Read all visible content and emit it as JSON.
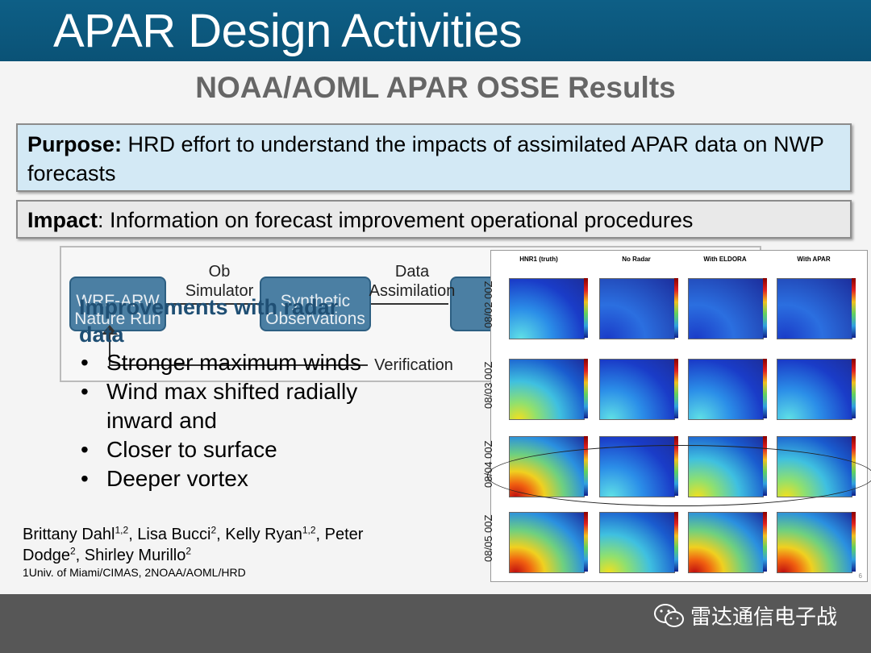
{
  "header": {
    "title": "APAR Design Activities"
  },
  "subtitle": "NOAA/AOML APAR OSSE Results",
  "purpose": {
    "label": "Purpose:",
    "text": " HRD effort to understand the impacts of assimilated APAR data on NWP forecasts"
  },
  "impact": {
    "label": "Impact",
    "text": ": Information on forecast improvement operational procedures"
  },
  "flow": {
    "nodes": [
      "WRF-ARW Nature Run",
      "Synthetic Observations"
    ],
    "labels": [
      "Ob Simulator",
      "Data Assimilation",
      "Verification"
    ]
  },
  "improvements": {
    "heading": "Improvements with radar data",
    "bullets": [
      "Stronger maximum winds",
      "Wind max shifted radially inward and",
      "Closer to surface",
      "Deeper vortex"
    ]
  },
  "authors": {
    "line1a": "Brittany Dahl",
    "sup1": "1,2",
    "line1b": ", Lisa Bucci",
    "sup2": "2",
    "line1c": ", Kelly Ryan",
    "sup3": "1,2",
    "line1d": ", Peter",
    "line2a": "Dodge",
    "sup4": "2",
    "line2b": ", Shirley Murillo",
    "sup5": "2",
    "affiliation": "1Univ. of Miami/CIMAS, 2NOAA/AOML/HRD"
  },
  "figure": {
    "columns": [
      "HNR1 (truth)",
      "No Radar",
      "With ELDORA",
      "With APAR"
    ],
    "dates": [
      "08/02 00Z",
      "08/03 00Z",
      "08/04 00Z",
      "08/05 00Z"
    ],
    "page_number": "6"
  },
  "watermark": "雷达通信电子战"
}
